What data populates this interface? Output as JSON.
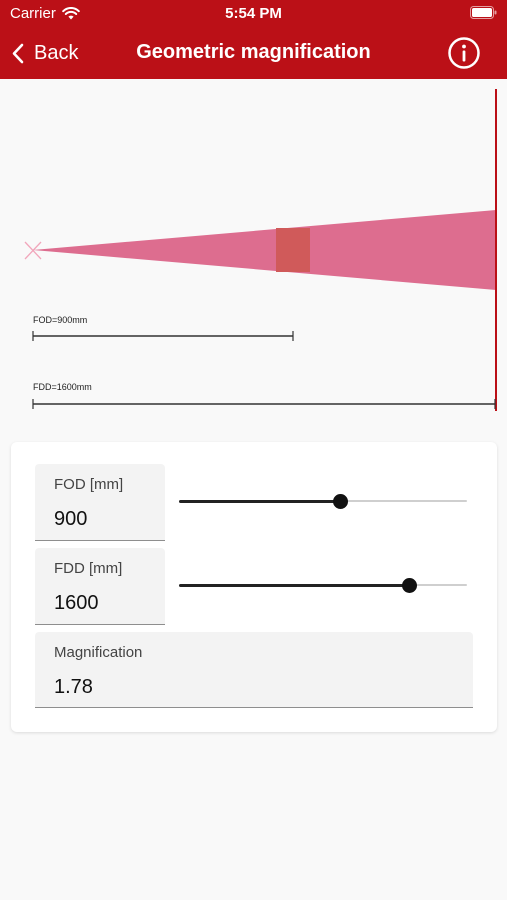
{
  "status_bar": {
    "carrier": "Carrier",
    "time": "5:54 PM"
  },
  "navbar": {
    "back_label": "Back",
    "title": "Geometric magnification"
  },
  "diagram": {
    "fod_label": "FOD=900mm",
    "fdd_label": "FDD=1600mm",
    "beam_color": "#dd6d8f",
    "object_color": "#d05a5a",
    "detector_color": "#bb1017"
  },
  "fod": {
    "label": "FOD [mm]",
    "value": "900",
    "slider_fraction": 0.56
  },
  "fdd": {
    "label": "FDD [mm]",
    "value": "1600",
    "slider_fraction": 0.8
  },
  "magnification": {
    "label": "Magnification",
    "value": "1.78"
  },
  "colors": {
    "accent": "#bb1017",
    "slider": "#111111"
  }
}
